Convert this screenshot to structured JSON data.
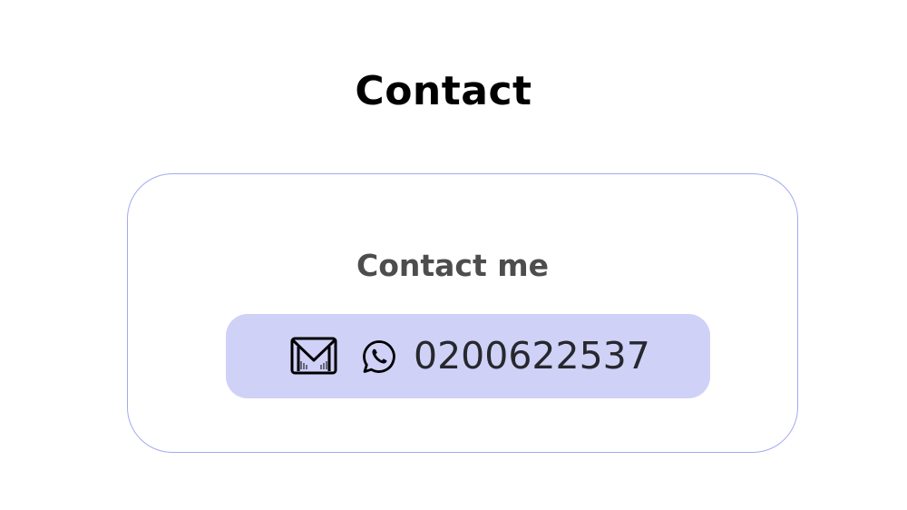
{
  "page": {
    "title": "Contact"
  },
  "contact_card": {
    "heading": "Contact me",
    "phone": "0200622537",
    "icons": [
      "mail-icon",
      "whatsapp-icon"
    ]
  },
  "colors": {
    "card_border": "#a3aaf0",
    "pill_background": "#cfd1f7",
    "heading_text": "#4d4d4d",
    "phone_text": "#27282e"
  }
}
